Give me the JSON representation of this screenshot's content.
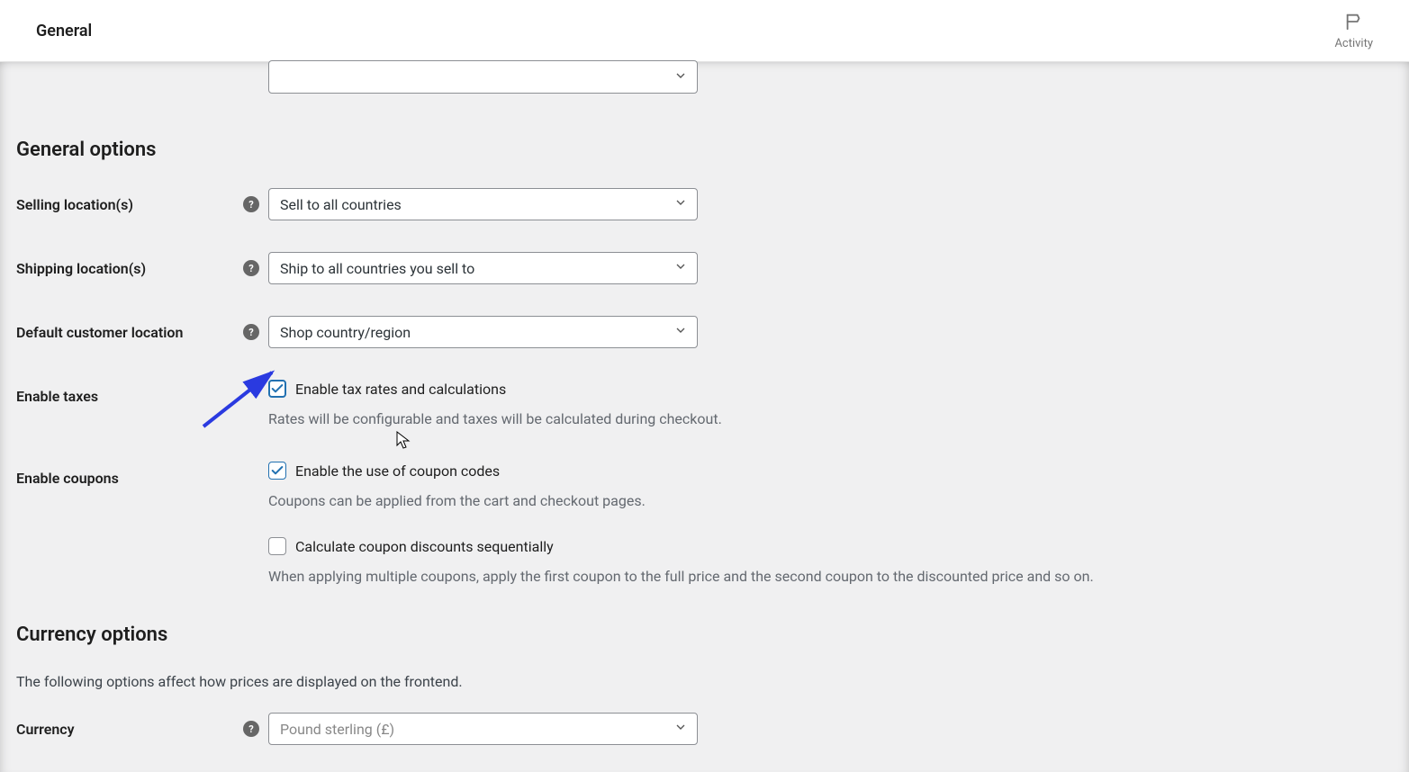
{
  "topbar": {
    "title": "General",
    "activity_label": "Activity"
  },
  "sections": {
    "general_options_title": "General options",
    "currency_options_title": "Currency options",
    "currency_options_desc": "The following options affect how prices are displayed on the frontend."
  },
  "fields": {
    "selling_locations": {
      "label": "Selling location(s)",
      "value": "Sell to all countries"
    },
    "shipping_locations": {
      "label": "Shipping location(s)",
      "value": "Ship to all countries you sell to"
    },
    "default_customer_location": {
      "label": "Default customer location",
      "value": "Shop country/region"
    },
    "enable_taxes": {
      "label": "Enable taxes",
      "checkbox_label": "Enable tax rates and calculations",
      "desc": "Rates will be configurable and taxes will be calculated during checkout.",
      "checked": true
    },
    "enable_coupons": {
      "label": "Enable coupons",
      "checkbox1_label": "Enable the use of coupon codes",
      "desc1": "Coupons can be applied from the cart and checkout pages.",
      "checkbox1_checked": true,
      "checkbox2_label": "Calculate coupon discounts sequentially",
      "desc2": "When applying multiple coupons, apply the first coupon to the full price and the second coupon to the discounted price and so on.",
      "checkbox2_checked": false
    },
    "currency": {
      "label": "Currency",
      "value": "Pound sterling (£)"
    }
  }
}
